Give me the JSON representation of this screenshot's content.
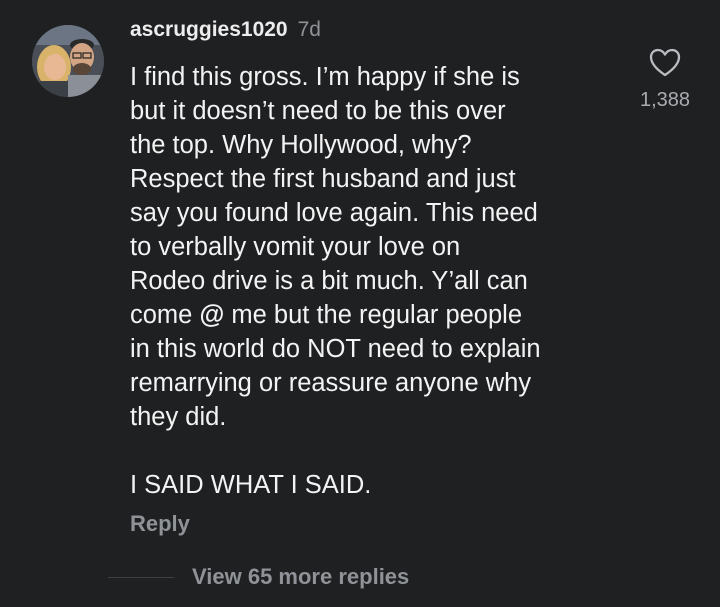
{
  "comment": {
    "username": "ascruggies1020",
    "timestamp": "7d",
    "lines": [
      "I find this gross. I’m happy if she is",
      "but it doesn’t need to be this over",
      "the top. Why Hollywood, why?",
      "Respect the first husband and just",
      "say you found love again. This need",
      "to verbally vomit your love on",
      "Rodeo drive is a bit much. Y’all can"
    ],
    "mention_line": {
      "before": "come ",
      "icon": "threads-icon",
      "after": " me but the regular people"
    },
    "lines_after": [
      "in this world do NOT need to explain",
      "remarrying or reassure anyone why",
      "they did."
    ],
    "closing": "I SAID WHAT I SAID.",
    "like_count": "1,388",
    "reply_label": "Reply",
    "view_replies_label": "View 65 more replies",
    "avatar_icon": "profile-photo",
    "like_icon": "heart-icon"
  }
}
